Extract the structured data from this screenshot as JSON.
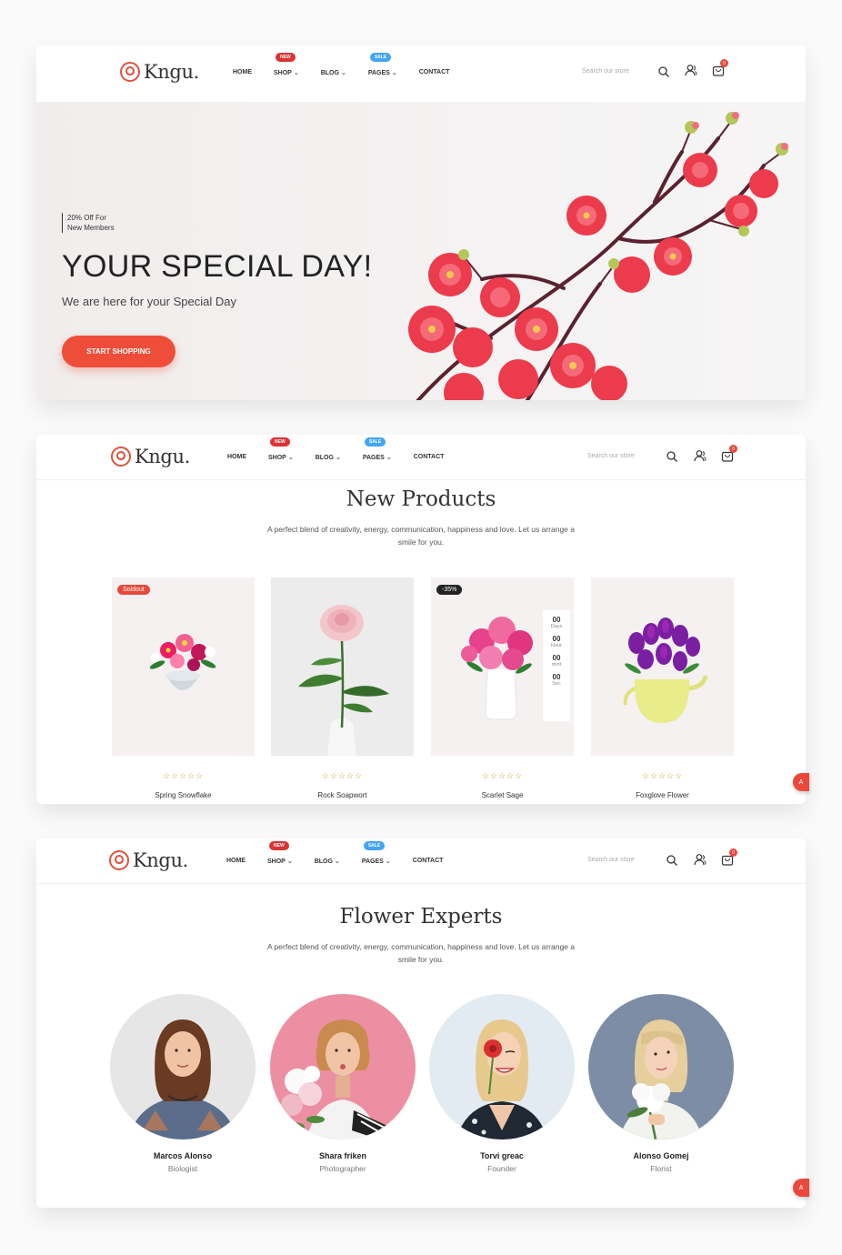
{
  "brand": {
    "name": "Kngu.",
    "accent": "#ee4d3a"
  },
  "nav": {
    "home": "HOME",
    "shop": "SHOP",
    "shop_badge": "NEW",
    "blog": "BLOG",
    "pages": "PAGES",
    "pages_badge": "SALE",
    "contact": "CONTACT",
    "search_placeholder": "Search our store",
    "cart_count": "0"
  },
  "hero": {
    "promo_line1": "20% Off For",
    "promo_line2": "New Members",
    "title": "YOUR SPECIAL DAY!",
    "subtitle": "We are here for your Special Day",
    "cta": "START SHOPPING"
  },
  "products_section": {
    "title": "New Products",
    "description": "A perfect blend of creativity, energy, communication, happiness and love. Let us arrange a smile for you.",
    "items": [
      {
        "name": "Spring Snowflake",
        "badge": "Soldout",
        "rating": "☆☆☆☆☆"
      },
      {
        "name": "Rock Soapwort",
        "badge": "",
        "rating": "☆☆☆☆☆"
      },
      {
        "name": "Scarlet Sage",
        "badge": "-35%",
        "rating": "☆☆☆☆☆"
      },
      {
        "name": "Foxglove Flower",
        "badge": "",
        "rating": "☆☆☆☆☆"
      }
    ],
    "countdown": [
      {
        "value": "00",
        "label": "Days"
      },
      {
        "value": "00",
        "label": "Hour"
      },
      {
        "value": "00",
        "label": "mint"
      },
      {
        "value": "00",
        "label": "Sec"
      }
    ]
  },
  "experts_section": {
    "title": "Flower Experts",
    "description": "A perfect blend of creativity, energy, communication, happiness and love. Let us arrange a smile for you.",
    "members": [
      {
        "name": "Marcos Alonso",
        "role": "Biologist"
      },
      {
        "name": "Shara friken",
        "role": "Photographer"
      },
      {
        "name": "Torvi greac",
        "role": "Founder"
      },
      {
        "name": "Alonso Gomej",
        "role": "Florist"
      }
    ]
  },
  "floating_button": {
    "label": "A"
  }
}
